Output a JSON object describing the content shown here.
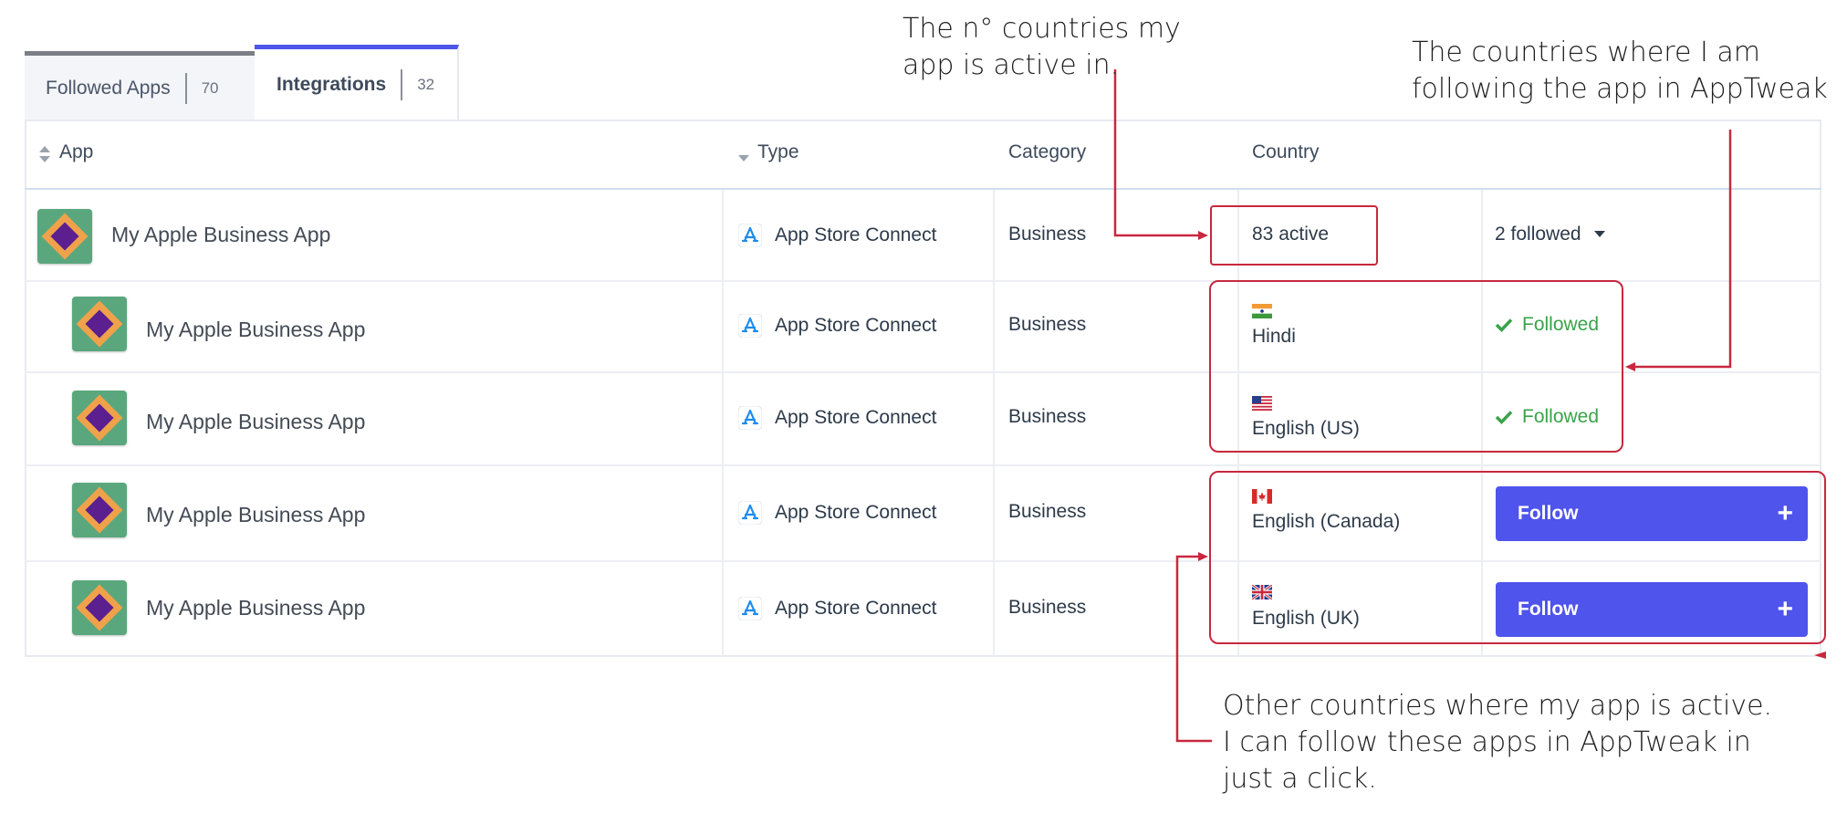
{
  "tabs": [
    {
      "label": "Followed Apps",
      "count": "70"
    },
    {
      "label": "Integrations",
      "count": "32"
    }
  ],
  "table": {
    "headers": {
      "app": "App",
      "type": "Type",
      "category": "Category",
      "country": "Country"
    },
    "rows": [
      {
        "app": "My Apple Business App",
        "type": "App Store Connect",
        "category": "Business",
        "country": "83 active",
        "status": "2 followed"
      },
      {
        "app": "My Apple Business App",
        "type": "App Store Connect",
        "category": "Business",
        "flag": "india-flag-icon",
        "country": "Hindi",
        "status": "Followed"
      },
      {
        "app": "My Apple Business App",
        "type": "App Store Connect",
        "category": "Business",
        "flag": "us-flag-icon",
        "country": "English (US)",
        "status": "Followed"
      },
      {
        "app": "My Apple Business App",
        "type": "App Store Connect",
        "category": "Business",
        "flag": "canada-flag-icon",
        "country": "English (Canada)",
        "status": "Follow"
      },
      {
        "app": "My Apple Business App",
        "type": "App Store Connect",
        "category": "Business",
        "flag": "uk-flag-icon",
        "country": "English (UK)",
        "status": "Follow"
      }
    ]
  },
  "annotations": {
    "active_count": [
      "The n° countries my",
      "app is active in."
    ],
    "following": [
      "The countries where I am",
      "following the app in AppTweak"
    ],
    "other": [
      "Other countries where my app is active.",
      "I can follow these apps in AppTweak in",
      "just a click."
    ]
  },
  "colors": {
    "accent": "#4f54ec",
    "followed_green": "#3aa34a",
    "annotation_red": "#c8283e",
    "app_icon_bg": "#5aa77d"
  }
}
